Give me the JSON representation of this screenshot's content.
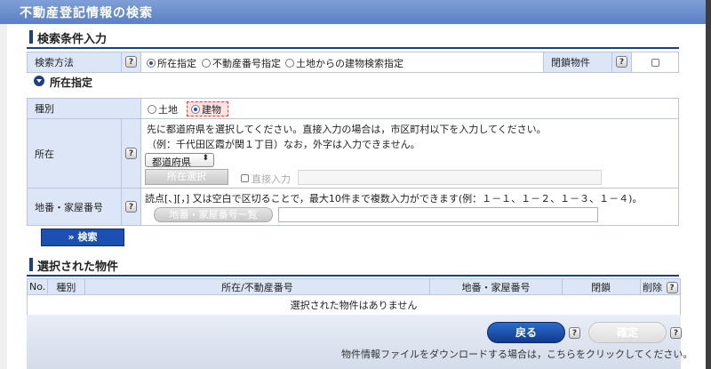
{
  "window": {
    "title": "不動産登記情報の検索"
  },
  "section_search": {
    "title": "検索条件入力"
  },
  "search_method": {
    "label": "検索方法",
    "help": "?",
    "options": [
      "所在指定",
      "不動産番号指定",
      "土地からの建物検索指定"
    ],
    "selected": "所在指定",
    "closed_label": "閉鎖物件"
  },
  "location_section": {
    "title": "所在指定"
  },
  "type_row": {
    "label": "種別",
    "options": [
      "土地",
      "建物"
    ],
    "selected": "建物"
  },
  "address_row": {
    "label": "所在",
    "help": "?",
    "instruction1": "先に都道府県を選択してください。直接入力の場合は，市区町村以下を入力してください。",
    "instruction2": "（例：千代田区霞が関１丁目）なお，外字は入力できません。",
    "prefecture_select": "都道府県",
    "select_button": "所在選択",
    "direct_input_label": "直接入力"
  },
  "lot_row": {
    "label": "地番・家屋番号",
    "help": "?",
    "instruction": "読点[、][，] 又は空白で区切ることで，最大10件まで複数入力ができます(例：１－１、１－２、１－３、１－４)。",
    "list_button": "地番・家屋番号一覧"
  },
  "search_button": {
    "label": "» 検索"
  },
  "section_selected": {
    "title": "選択された物件"
  },
  "results_table": {
    "headers": [
      "No.",
      "種別",
      "所在/不動産番号",
      "地番・家屋番号",
      "閉鎖",
      "削除"
    ],
    "help": "?",
    "empty_message": "選択された物件はありません"
  },
  "footer": {
    "back_button": "戻る",
    "confirm_button": "確定",
    "help": "?",
    "download_text": "物件情報ファイルをダウンロードする場合は，こちらをクリックしてください。"
  }
}
